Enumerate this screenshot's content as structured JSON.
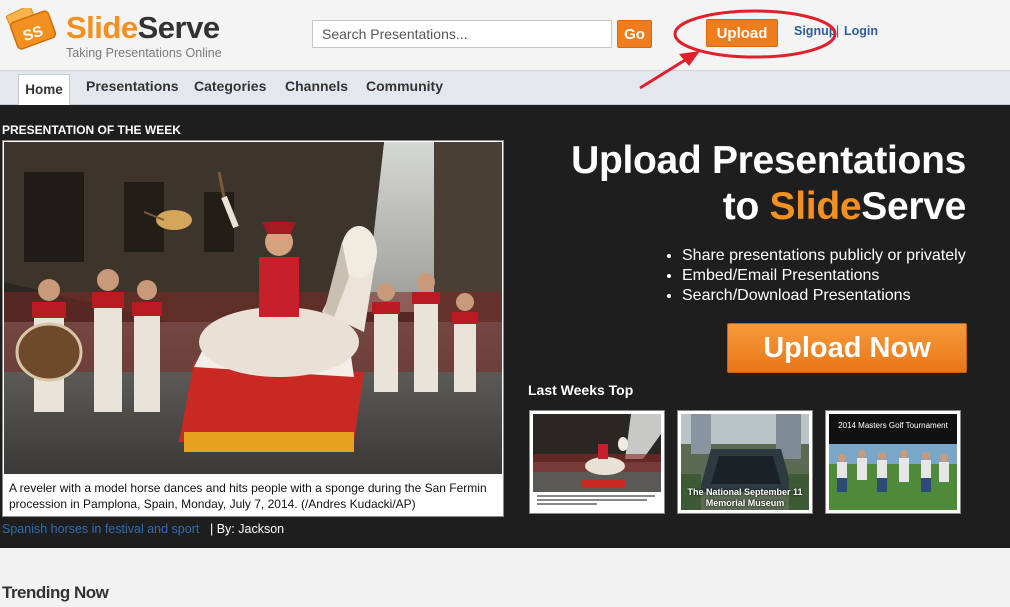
{
  "header": {
    "brand_slide": "Slide",
    "brand_serve": "Serve",
    "tagline": "Taking Presentations Online",
    "search_placeholder": "Search Presentations...",
    "go_label": "Go",
    "upload_label": "Upload",
    "signup_label": "Signup",
    "separator": "|",
    "login_label": "Login"
  },
  "nav": {
    "items": [
      {
        "label": "Home"
      },
      {
        "label": "Presentations"
      },
      {
        "label": "Categories"
      },
      {
        "label": "Channels"
      },
      {
        "label": "Community"
      }
    ]
  },
  "hero": {
    "potw_label": "PRESENTATION OF THE WEEK",
    "caption": "A reveler with a model horse dances and hits people with a sponge during the San Fermin procession in Pamplona, Spain, Monday, July 7, 2014. (/Andres Kudacki/AP)",
    "feature_title": "Spanish horses in festival and sport",
    "byline": "| By: Jackson",
    "headline_line1": "Upload Presentations",
    "headline_to": "to ",
    "headline_slide": "Slide",
    "headline_serve": "Serve",
    "features": [
      "Share presentations publicly or privately",
      "Embed/Email Presentations",
      "Search/Download Presentations"
    ],
    "upload_now_label": "Upload Now",
    "last_weeks_top": "Last Weeks Top",
    "thumbnails": [
      {
        "title": ""
      },
      {
        "title": "The National September 11 Memorial Museum"
      },
      {
        "title": "2014 Masters Golf Tournament"
      }
    ]
  },
  "trending_heading": "Trending Now",
  "colors": {
    "accent_orange": "#ef7d1d",
    "link_blue": "#2d5f9a",
    "hero_bg": "#1e1e1e",
    "annotation_red": "#e0202a"
  }
}
